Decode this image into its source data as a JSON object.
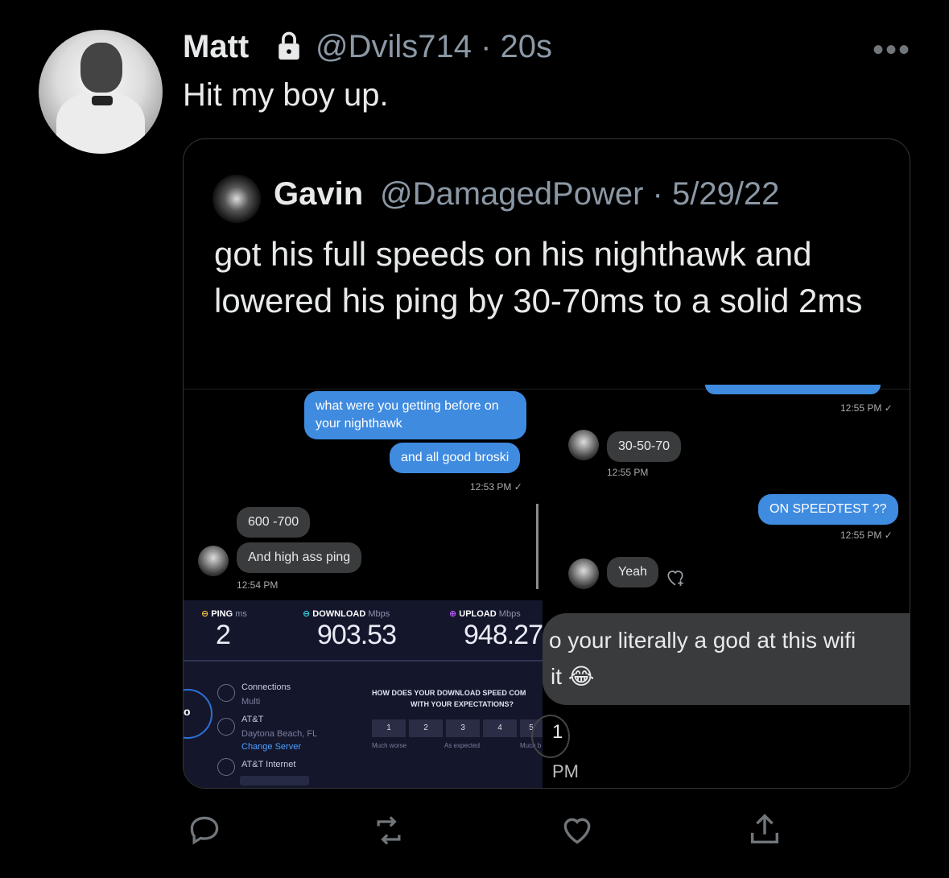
{
  "tweet": {
    "author_name": "Matt",
    "handle_time": "@Dvils714 · 20s",
    "text": "Hit my boy up.",
    "more_label": "•••"
  },
  "quote": {
    "author_name": "Gavin",
    "handle_date": "@DamagedPower · 5/29/22",
    "text": "got his full speeds on his nighthawk and lowered his ping by 30-70ms to a solid 2ms"
  },
  "chat_left": {
    "msg1": "what were you getting before on",
    "msg1b": "your nighthawk",
    "msg2": "and all good broski",
    "ts1": "12:53 PM ✓",
    "reply1": "600 -700",
    "reply2": "And high ass ping",
    "ts2": "12:54 PM"
  },
  "chat_right": {
    "ts_top": "12:55 PM ✓",
    "reply1": "30-50-70",
    "ts1": "12:55 PM",
    "msg1": "ON SPEEDTEST ??",
    "ts2": "12:55 PM ✓",
    "reply2": "Yeah"
  },
  "speedtest": {
    "ping_label": "PING",
    "ping_unit": "ms",
    "ping_value": "2",
    "download_label": "DOWNLOAD",
    "download_unit": "Mbps",
    "download_value": "903.53",
    "upload_label": "UPLOAD",
    "upload_unit": "Mbps",
    "upload_value": "948.27",
    "connections_label": "Connections",
    "connections_value": "Multi",
    "isp": "AT&T",
    "location": "Daytona Beach, FL",
    "change_server": "Change Server",
    "isp2": "AT&T Internet",
    "survey_line1": "HOW DOES YOUR DOWNLOAD SPEED COM",
    "survey_line2": "WITH YOUR EXPECTATIONS?",
    "scale": [
      "1",
      "2",
      "3",
      "4",
      "5"
    ],
    "scale_low": "Much worse",
    "scale_mid": "As expected",
    "scale_high": "Much b",
    "go_fragment": "o"
  },
  "big_bubble": {
    "line1": "o your literally a god at this wifi",
    "line2": "it 😂",
    "badge": "1",
    "time_fragment": "PM"
  },
  "colors": {
    "background": "#000000",
    "text_primary": "#e7e9ea",
    "text_secondary": "#8b98a5",
    "bubble_out": "#3f8be0",
    "bubble_in": "#3a3b3c"
  }
}
